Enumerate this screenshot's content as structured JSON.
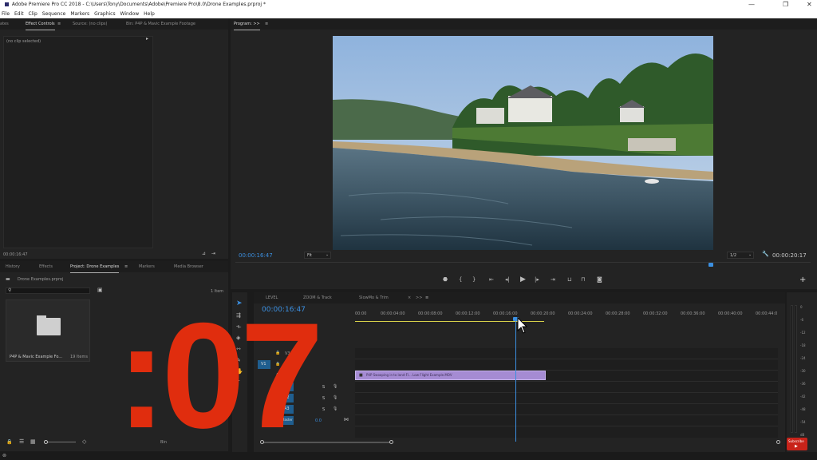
{
  "window": {
    "title": "Adobe Premiere Pro CC 2018 - C:\\Users\\Tony\\Documents\\Adobe\\Premiere Pro\\8.0\\Drone Examples.prproj *",
    "controls": [
      "—",
      "❐",
      "✕"
    ]
  },
  "menu": [
    "File",
    "Edit",
    "Clip",
    "Sequence",
    "Markers",
    "Graphics",
    "Window",
    "Help"
  ],
  "source_panel": {
    "tabs": [
      "ates",
      "Effect Controls",
      "Source: (no clips)",
      "Bin: P4P & Mavic Example Footage"
    ],
    "active_tab": "Effect Controls",
    "no_clip": "(no clip selected)",
    "timecode": "00:00:16:47"
  },
  "program_panel": {
    "tab": "Program: >>",
    "timecode_current": "00:00:16:47",
    "fit": "Fit",
    "resolution": "1/2",
    "timecode_duration": "00:00:20:17"
  },
  "project_panel": {
    "tabs": [
      "History",
      "Effects",
      "Project: Drone Examples",
      "Markers",
      "Media Browser"
    ],
    "active_tab": "Project: Drone Examples",
    "project_file": "Drone Examples.prproj",
    "item_count": "1 Item",
    "bin_name": "P4P & Mavic Example Fo...",
    "bin_count": "19 Items",
    "bottom_label": "Bin"
  },
  "timeline": {
    "tabs": [
      "LEVEL",
      "ZOOM & Track",
      "SlowMo & Trim",
      "×",
      ">>"
    ],
    "timecode": "00:00:16:47",
    "ruler": [
      "00:00",
      "00:00:04:00",
      "00:00:08:00",
      "00:00:12:00",
      "00:00:16:00",
      "00:00:20:00",
      "00:00:24:00",
      "00:00:28:00",
      "00:00:32:00",
      "00:00:36:00",
      "00:00:40:00",
      "00:00:44:0"
    ],
    "tracks": [
      {
        "id": "V3",
        "type": "video"
      },
      {
        "id": "V2",
        "type": "video"
      },
      {
        "id": "V1",
        "type": "video"
      },
      {
        "id": "A1",
        "type": "audio"
      },
      {
        "id": "A2",
        "type": "audio"
      },
      {
        "id": "A3",
        "type": "audio"
      },
      {
        "id": "Master",
        "type": "master"
      }
    ],
    "source_patch": "V1",
    "master_level": "0.0",
    "clip_name": "P4P Swooping in to land-Fl... Low Flight Example.MOV",
    "playhead_fraction": 0.38,
    "clip_end_fraction": 0.45
  },
  "meter_scale": [
    "0",
    "-6",
    "-12",
    "-18",
    "-24",
    "-30",
    "-36",
    "-42",
    "-48",
    "-54",
    "dB"
  ],
  "overlay_counter": ":07",
  "subscribe_label": "Subscribe",
  "colors": {
    "accent_blue": "#3b8fe0",
    "clip_purple": "#a58bd3",
    "counter_red": "#e02d0e",
    "work_area_yellow": "#d7d14a"
  },
  "icons": [
    "select-tool-icon",
    "ripple-tool-icon",
    "razor-tool-icon",
    "slip-tool-icon",
    "pen-tool-icon",
    "hand-tool-icon",
    "type-tool-icon",
    "play-icon",
    "step-back-icon",
    "step-forward-icon",
    "export-frame-icon",
    "wrench-icon",
    "add-icon",
    "search-icon",
    "new-bin-icon",
    "lock-icon"
  ]
}
